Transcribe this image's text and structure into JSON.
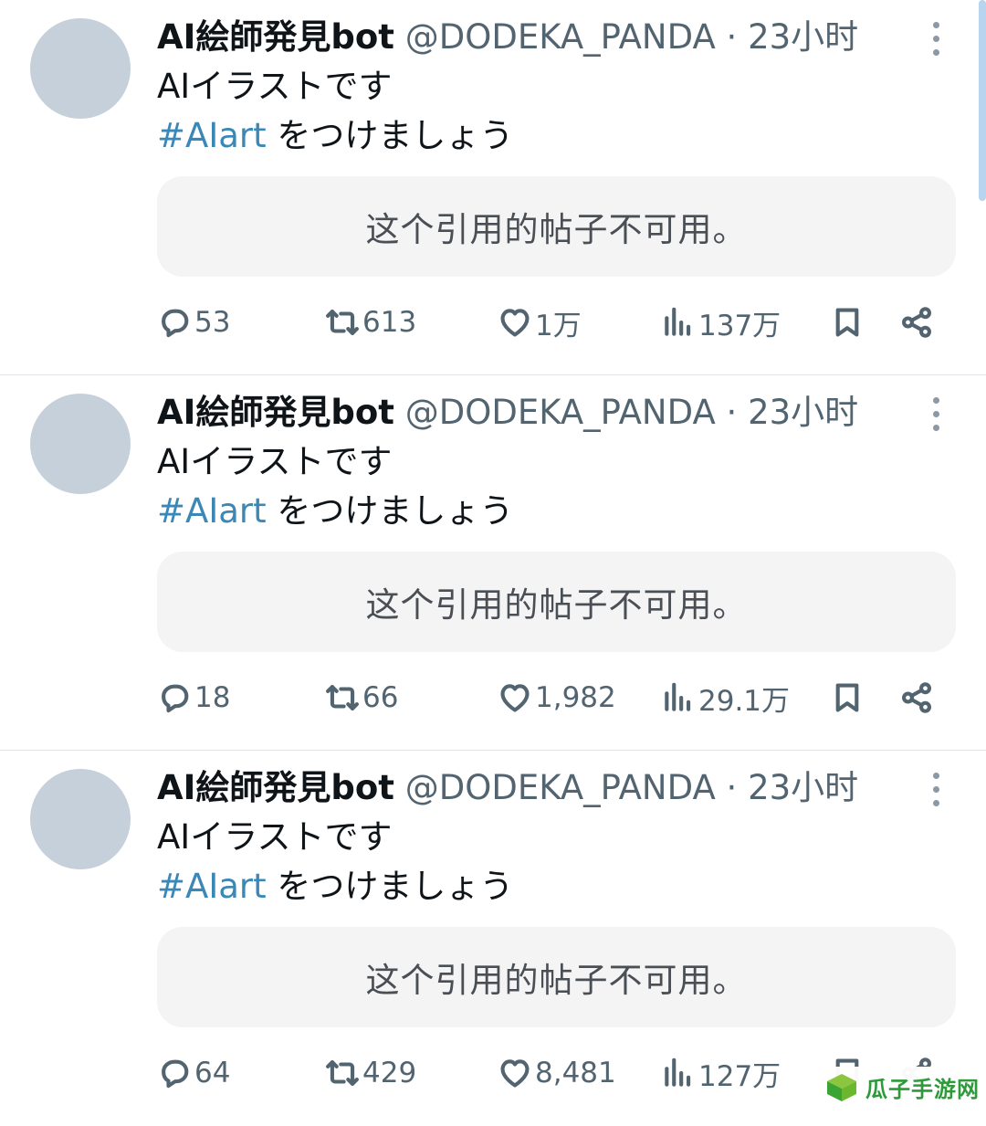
{
  "tweets": [
    {
      "display_name": "AI絵師発見bot",
      "handle": "@DODEKA_PANDA",
      "separator": "·",
      "time": "23小时",
      "text_line1": "AIイラストです",
      "hashtag": "#AIart",
      "text_line2_rest": " をつけましょう",
      "quote_unavailable": "这个引用的帖子不可用。",
      "replies": "53",
      "retweets": "613",
      "likes": "1万",
      "views": "137万"
    },
    {
      "display_name": "AI絵師発見bot",
      "handle": "@DODEKA_PANDA",
      "separator": "·",
      "time": "23小时",
      "text_line1": "AIイラストです",
      "hashtag": "#AIart",
      "text_line2_rest": " をつけましょう",
      "quote_unavailable": "这个引用的帖子不可用。",
      "replies": "18",
      "retweets": "66",
      "likes": "1,982",
      "views": "29.1万"
    },
    {
      "display_name": "AI絵師発見bot",
      "handle": "@DODEKA_PANDA",
      "separator": "·",
      "time": "23小时",
      "text_line1": "AIイラストです",
      "hashtag": "#AIart",
      "text_line2_rest": " をつけましょう",
      "quote_unavailable": "这个引用的帖子不可用。",
      "replies": "64",
      "retweets": "429",
      "likes": "8,481",
      "views": "127万"
    }
  ],
  "icons": {
    "reply": "reply-icon",
    "retweet": "retweet-icon",
    "like": "heart-icon",
    "views": "views-icon",
    "bookmark": "bookmark-icon",
    "share": "share-icon",
    "more": "more-vertical-icon"
  },
  "colors": {
    "hashtag": "#3b88b7",
    "muted": "#536471",
    "avatar": "#c5d0db",
    "quote_bg": "#f4f4f5",
    "watermark": "#2e9a3a"
  },
  "watermark": {
    "text": "瓜子手游网"
  }
}
